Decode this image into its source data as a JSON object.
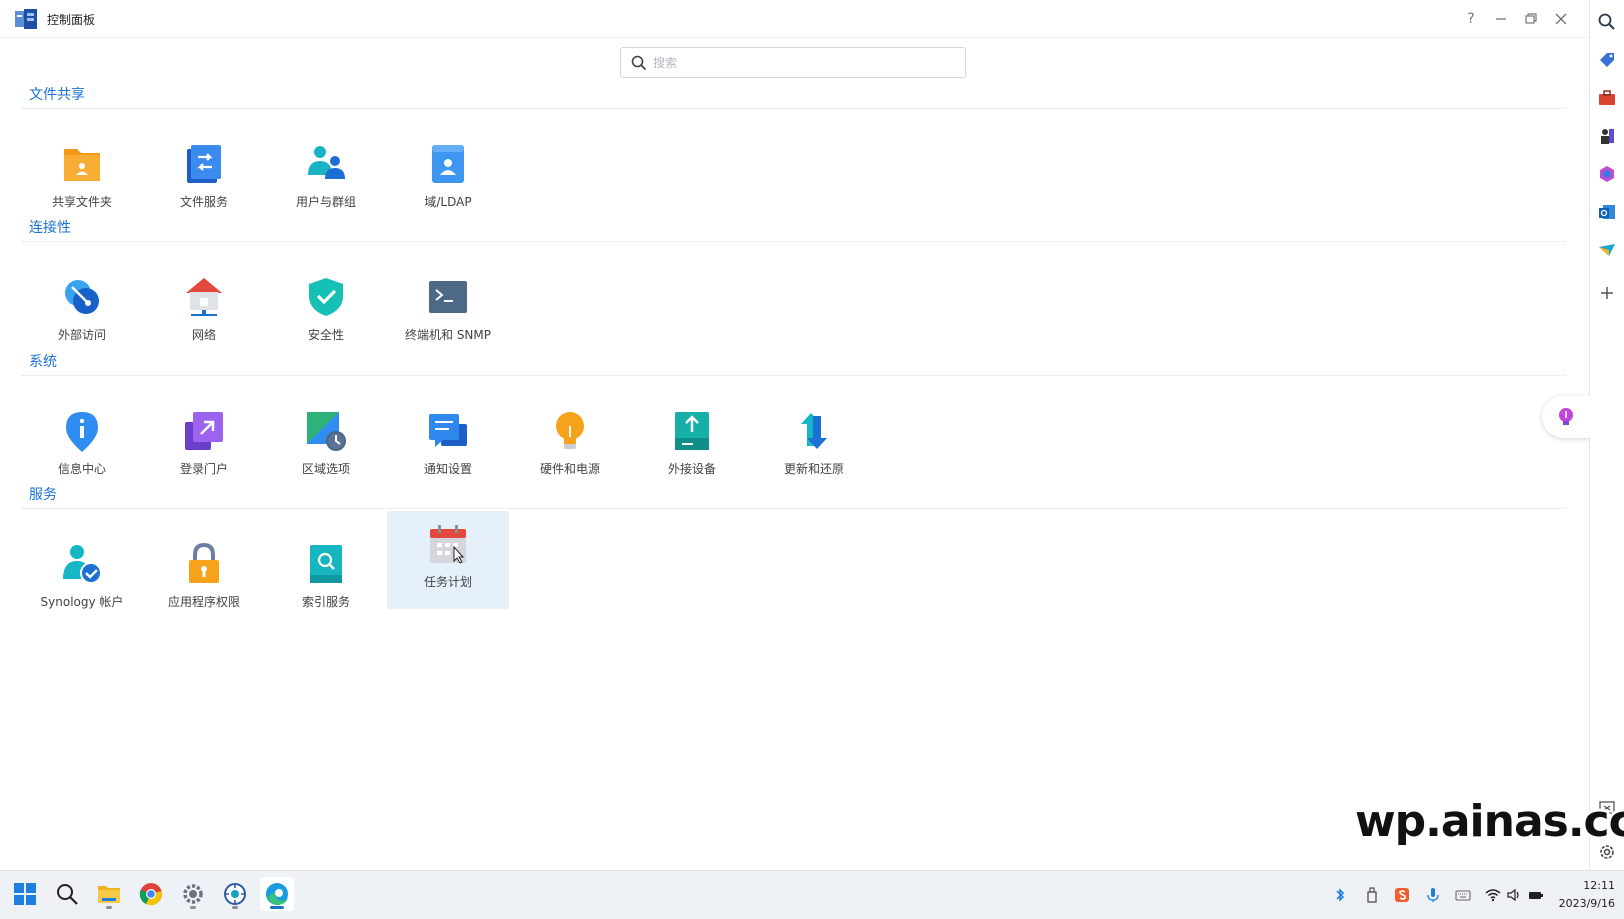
{
  "window": {
    "title": "控制面板"
  },
  "search": {
    "placeholder": "搜索"
  },
  "sections": [
    {
      "title": "文件共享",
      "items": [
        "共享文件夹",
        "文件服务",
        "用户与群组",
        "域/LDAP"
      ]
    },
    {
      "title": "连接性",
      "items": [
        "外部访问",
        "网络",
        "安全性",
        "终端机和 SNMP"
      ]
    },
    {
      "title": "系统",
      "items": [
        "信息中心",
        "登录门户",
        "区域选项",
        "通知设置",
        "硬件和电源",
        "外接设备",
        "更新和还原"
      ]
    },
    {
      "title": "服务",
      "items": [
        "Synology 帐户",
        "应用程序权限",
        "索引服务",
        "任务计划"
      ]
    }
  ],
  "selected_item": "任务计划",
  "watermark": "wp.ainas.cc",
  "taskbar": {
    "time": "12:11",
    "date": "2023/9/16"
  },
  "colors": {
    "section_title": "#1a73d3",
    "selected_bg": "#e6f0fb",
    "taskbar_bg": "#eef1f6"
  }
}
